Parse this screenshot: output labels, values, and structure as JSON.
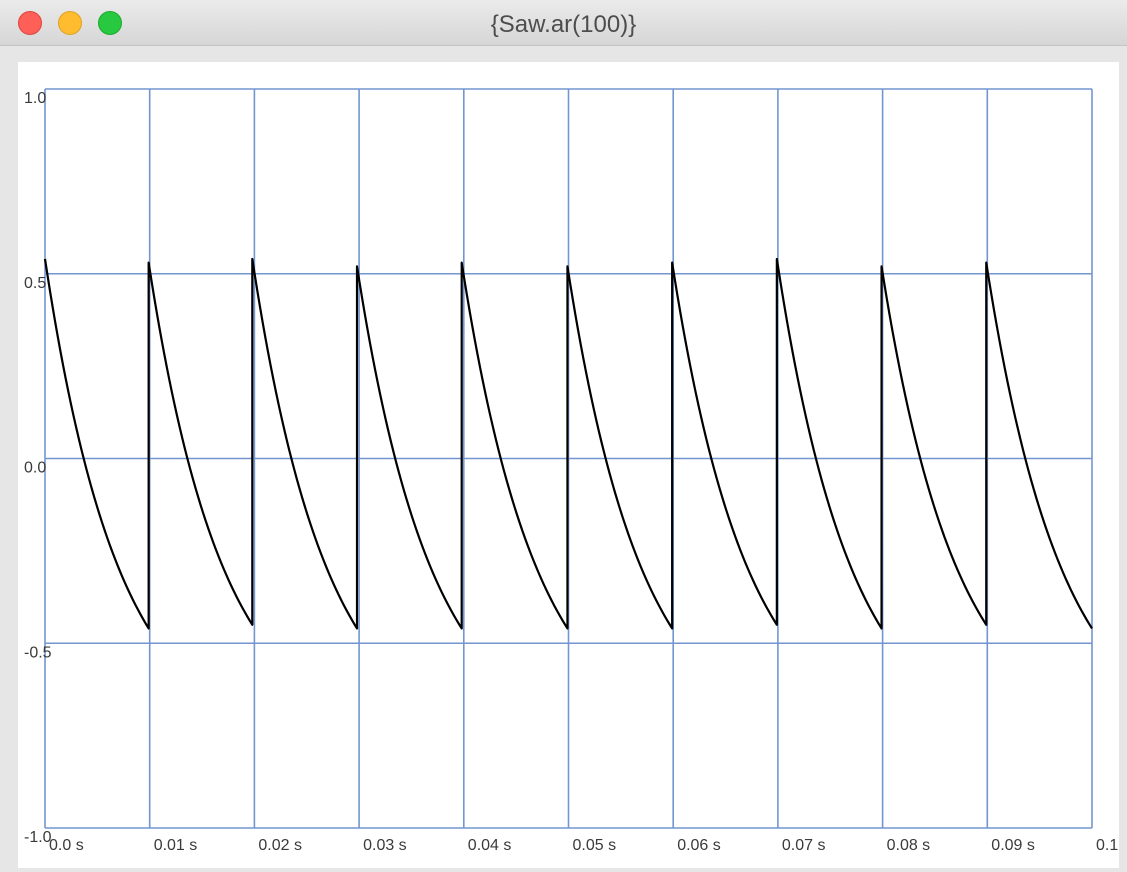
{
  "window": {
    "title": "{Saw.ar(100)}"
  },
  "chart_data": {
    "type": "line",
    "xlabel": "",
    "ylabel": "",
    "xlim": [
      0,
      0.1
    ],
    "ylim": [
      -1,
      1
    ],
    "x_ticks": [
      0,
      0.01,
      0.02,
      0.03,
      0.04,
      0.05,
      0.06,
      0.07,
      0.08,
      0.09,
      0.1
    ],
    "x_tick_labels": [
      "0.0 s",
      "0.01 s",
      "0.02 s",
      "0.03 s",
      "0.04 s",
      "0.05 s",
      "0.06 s",
      "0.07 s",
      "0.08 s",
      "0.09 s",
      "0.1"
    ],
    "y_ticks": [
      1,
      0.5,
      0,
      -0.5,
      -1
    ],
    "y_tick_labels": [
      "1.0",
      "0.5",
      "0.0",
      "-0.5",
      "-1.0"
    ],
    "grid": true,
    "colors": {
      "grid": "#7396d1",
      "line": "#000000"
    },
    "series": [
      {
        "frequency_hz": 100,
        "period_s": 0.01,
        "peak": 0.54,
        "trough": -0.46,
        "x": [
          0.0,
          0.0099,
          0.0099,
          0.0198,
          0.0198,
          0.0298,
          0.0298,
          0.0398,
          0.0398,
          0.0499,
          0.0499,
          0.0599,
          0.0599,
          0.0699,
          0.0699,
          0.0799,
          0.0799,
          0.0899,
          0.0899,
          0.1
        ],
        "y": [
          0.54,
          -0.46,
          0.53,
          -0.45,
          0.54,
          -0.46,
          0.52,
          -0.46,
          0.53,
          -0.46,
          0.52,
          -0.46,
          0.53,
          -0.45,
          0.54,
          -0.46,
          0.52,
          -0.45,
          0.53,
          -0.46
        ]
      }
    ]
  }
}
